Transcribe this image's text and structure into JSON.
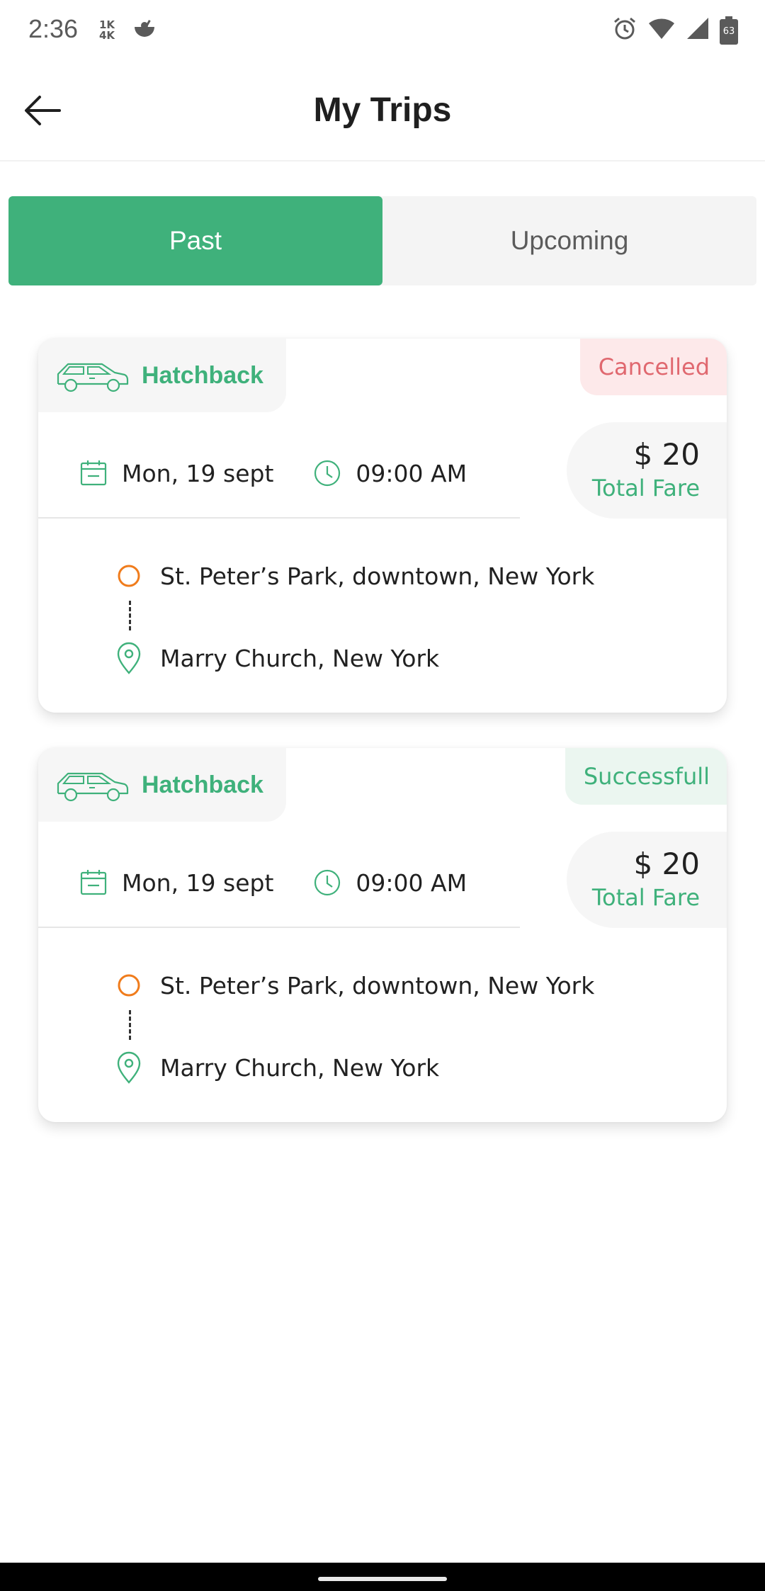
{
  "status_bar": {
    "time": "2:36",
    "data_top": "1K",
    "data_bottom": "4K",
    "battery": "63"
  },
  "header": {
    "title": "My Trips"
  },
  "tabs": [
    {
      "label": "Past",
      "active": true
    },
    {
      "label": "Upcoming",
      "active": false
    }
  ],
  "trips": [
    {
      "vehicle": "Hatchback",
      "status": "Cancelled",
      "date": "Mon, 19 sept",
      "time": "09:00 AM",
      "fare": "$ 20",
      "fare_label": "Total Fare",
      "pickup": "St. Peter’s Park, downtown, New York",
      "dropoff": "Marry Church, New York"
    },
    {
      "vehicle": "Hatchback",
      "status": "Successfull",
      "date": "Mon, 19 sept",
      "time": "09:00 AM",
      "fare": "$ 20",
      "fare_label": "Total Fare",
      "pickup": "St. Peter’s Park, downtown, New York",
      "dropoff": "Marry Church, New York"
    }
  ],
  "colors": {
    "accent": "#3fb17b",
    "cancelled": "#e0686f",
    "pickup_marker": "#f07c1c"
  }
}
